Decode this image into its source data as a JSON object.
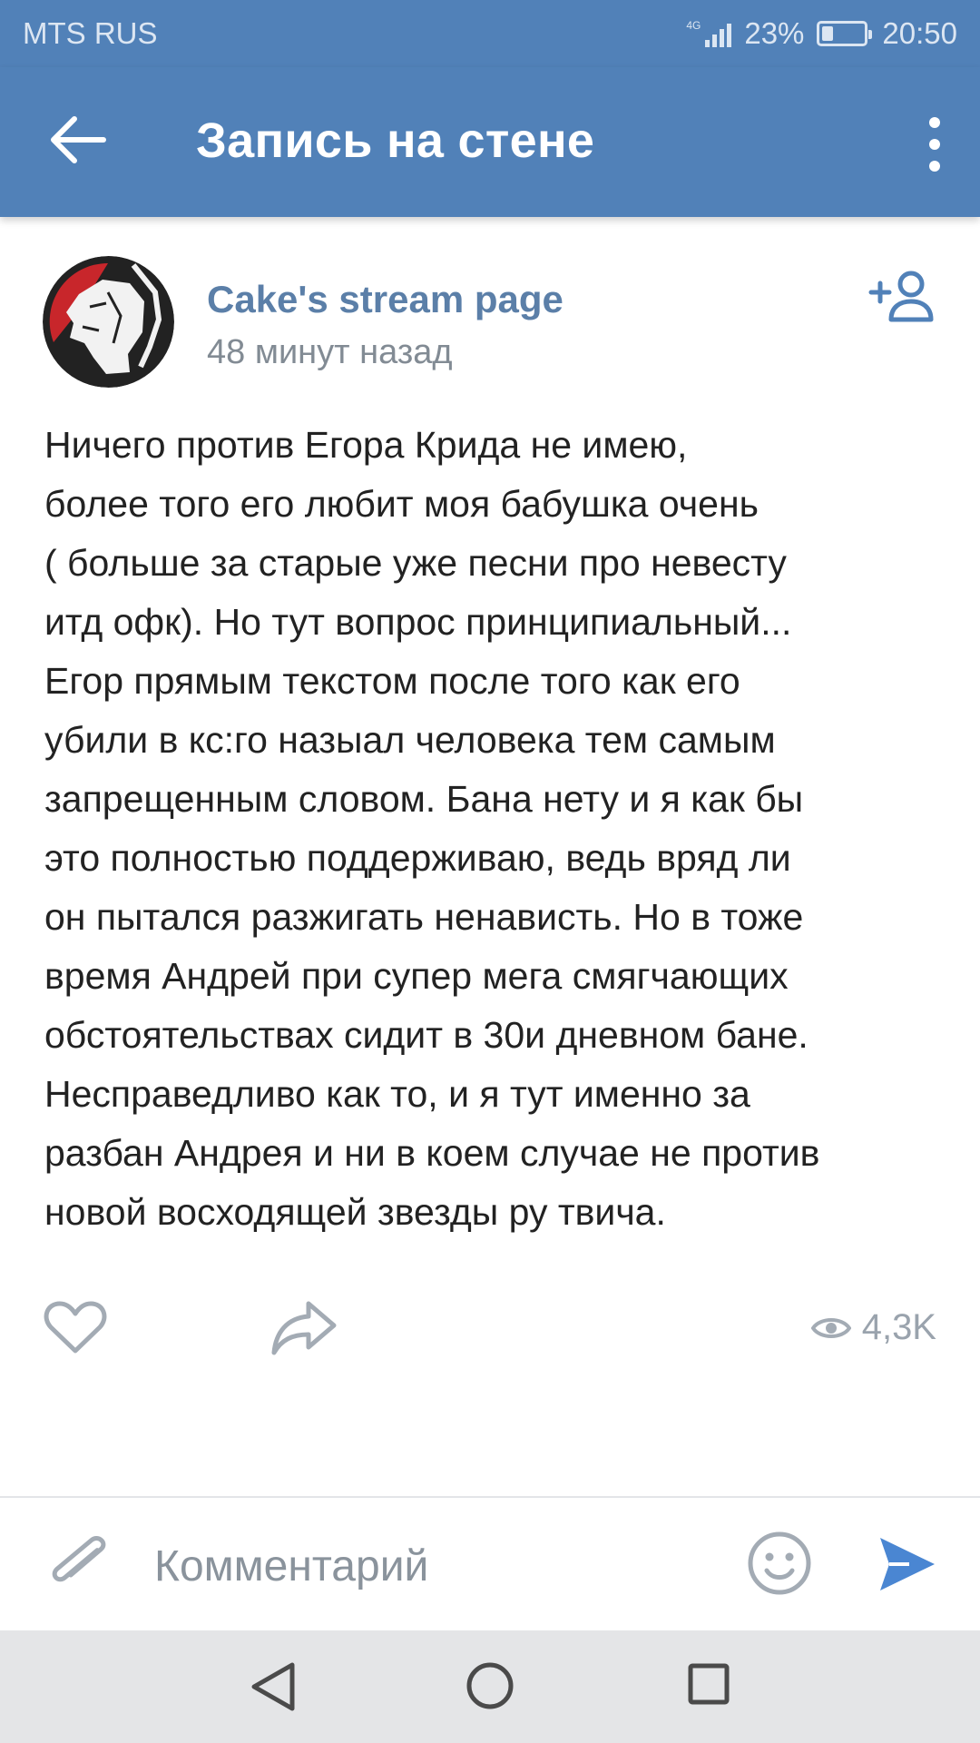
{
  "status_bar": {
    "carrier": "MTS RUS",
    "network": "4G",
    "battery": "23%",
    "battery_level": 0.23,
    "time": "20:50"
  },
  "app_bar": {
    "title": "Запись на стене",
    "back_icon": "arrow-left-icon",
    "menu_icon": "more-vertical-icon"
  },
  "post": {
    "author": "Cake's stream page",
    "time": "48 минут назад",
    "add_friend_icon": "add-friend-icon",
    "lines": [
      "Ничего против Егора Крида не имею,",
      "более того его любит моя бабушка очень",
      "( больше за старые уже песни про невесту",
      "итд офк). Но тут вопрос принципиальный...",
      "Егор прямым текстом после того как его",
      "убили в кс:го назыал человека тем самым",
      "запрещенным словом. Бана нету и я как бы",
      "это полностью поддерживаю, ведь вряд ли",
      "он пытался разжигать ненависть. Но в тоже",
      "время Андрей при супер мега смягчающих",
      "обстоятельствах сидит в 30и дневном бане.",
      "Несправедливо как то, и я тут именно за",
      "разбан Андрея и ни в коем случае не против",
      "новой восходящей звезды ру твича."
    ],
    "views": "4,3K"
  },
  "comment_bar": {
    "placeholder": "Комментарий",
    "attach_icon": "paperclip-icon",
    "emoji_icon": "smile-icon",
    "send_icon": "send-icon"
  },
  "colors": {
    "header": "#5181b8",
    "author": "#5b7fa8",
    "icon_gray": "#a3abb4",
    "send": "#4a86d2"
  }
}
